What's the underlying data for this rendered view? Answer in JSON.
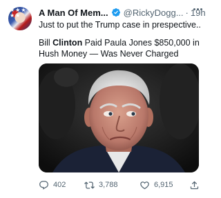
{
  "tweet": {
    "display_name": "A Man Of Mem...",
    "handle": "@RickyDogg...",
    "separator": "·",
    "time": "19h",
    "text_line1": "Just to put the Trump case in prespective....",
    "text_part1": "Bill ",
    "text_bold": "Clinton",
    "text_part2": " Paid Paula Jones $850,000 in Hush Money — Was Never Charged",
    "actions": {
      "replies": "402",
      "retweets": "3,788",
      "likes": "6,915"
    }
  },
  "icons": {
    "verified": "verified-badge-icon",
    "more": "more-icon",
    "reply": "reply-icon",
    "retweet": "retweet-icon",
    "like": "heart-icon",
    "share": "share-icon"
  },
  "colors": {
    "verified": "#1d9bf0",
    "secondary_text": "#536471",
    "primary_text": "#0f1419"
  }
}
